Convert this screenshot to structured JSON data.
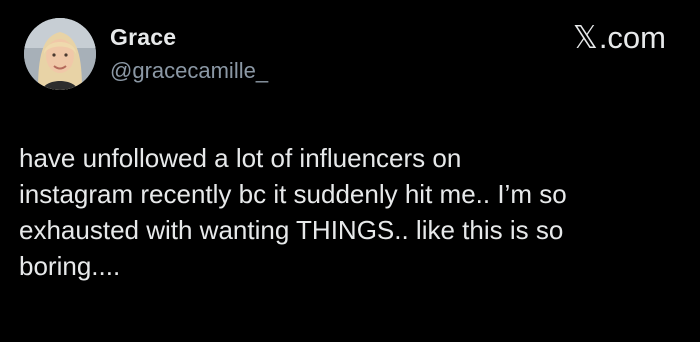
{
  "author": {
    "display_name": "Grace",
    "handle": "@gracecamille_",
    "avatar_icon": "user-avatar-photo"
  },
  "brand": {
    "x_mark": "𝕏",
    "domain_suffix": ".com"
  },
  "tweet": {
    "lines": [
      "have unfollowed a lot of influencers on",
      "instagram recently bc it suddenly hit me.. I’m so",
      "exhausted with wanting THINGS.. like this is so",
      "boring...."
    ]
  },
  "colors": {
    "background": "#000000",
    "primary_text": "#e7e9ea",
    "secondary_text": "#8b98a5"
  }
}
